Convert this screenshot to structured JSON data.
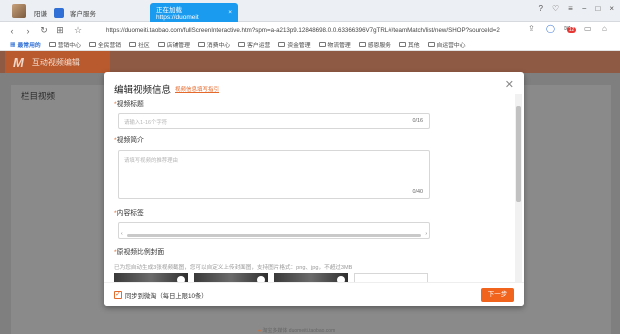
{
  "browser": {
    "tabs": [
      {
        "label": "阳谦"
      },
      {
        "label": "客户服务"
      },
      {
        "label": "正在加载 https://duomeit"
      }
    ],
    "address": "https://duomeiti.taobao.com/fullScreenInteractive.htm?spm=a-a213p9.12848698.0.0.63366396V7gTRL#/teamMatch/list/new/SHOP?sourceId=2",
    "notification_count": "12",
    "bookmarks": [
      "最常用的",
      "营销中心",
      "全民营销",
      "社区",
      "店铺管理",
      "消费中心",
      "客户运营",
      "资金管理",
      "物流管理",
      "感恩服务",
      "其他",
      "自运营中心"
    ]
  },
  "app": {
    "brand_logo": "M",
    "brand_title": "互动视频编辑",
    "card_title": "栏目视频",
    "footer_hint": "淘宝多媒体 duomeiti.taobao.com"
  },
  "modal": {
    "title": "编辑视频信息",
    "guide_link": "视频信息填写指引",
    "video_title_label": "视频标题",
    "video_title_placeholder": "请输入1-16个字符",
    "video_title_count": "0/16",
    "video_desc_label": "视频简介",
    "video_desc_placeholder": "请填写视频的推荐理由",
    "video_desc_count": "0/40",
    "content_tags_label": "内容标签",
    "cover_label": "原视频比例封面",
    "cover_hint": "已为您自动生成3张视频截图，您可以自定义上传封面图，支持图片格式：png、jpg，不超过3MB",
    "sync_checkbox_label": "同步到微淘（每日上限10条）",
    "next_button": "下一步",
    "required_mark": "*"
  },
  "colors": {
    "accent": "#f0641e",
    "tab_active": "#1a9bf0",
    "brand_bar": "#b85a2e"
  }
}
